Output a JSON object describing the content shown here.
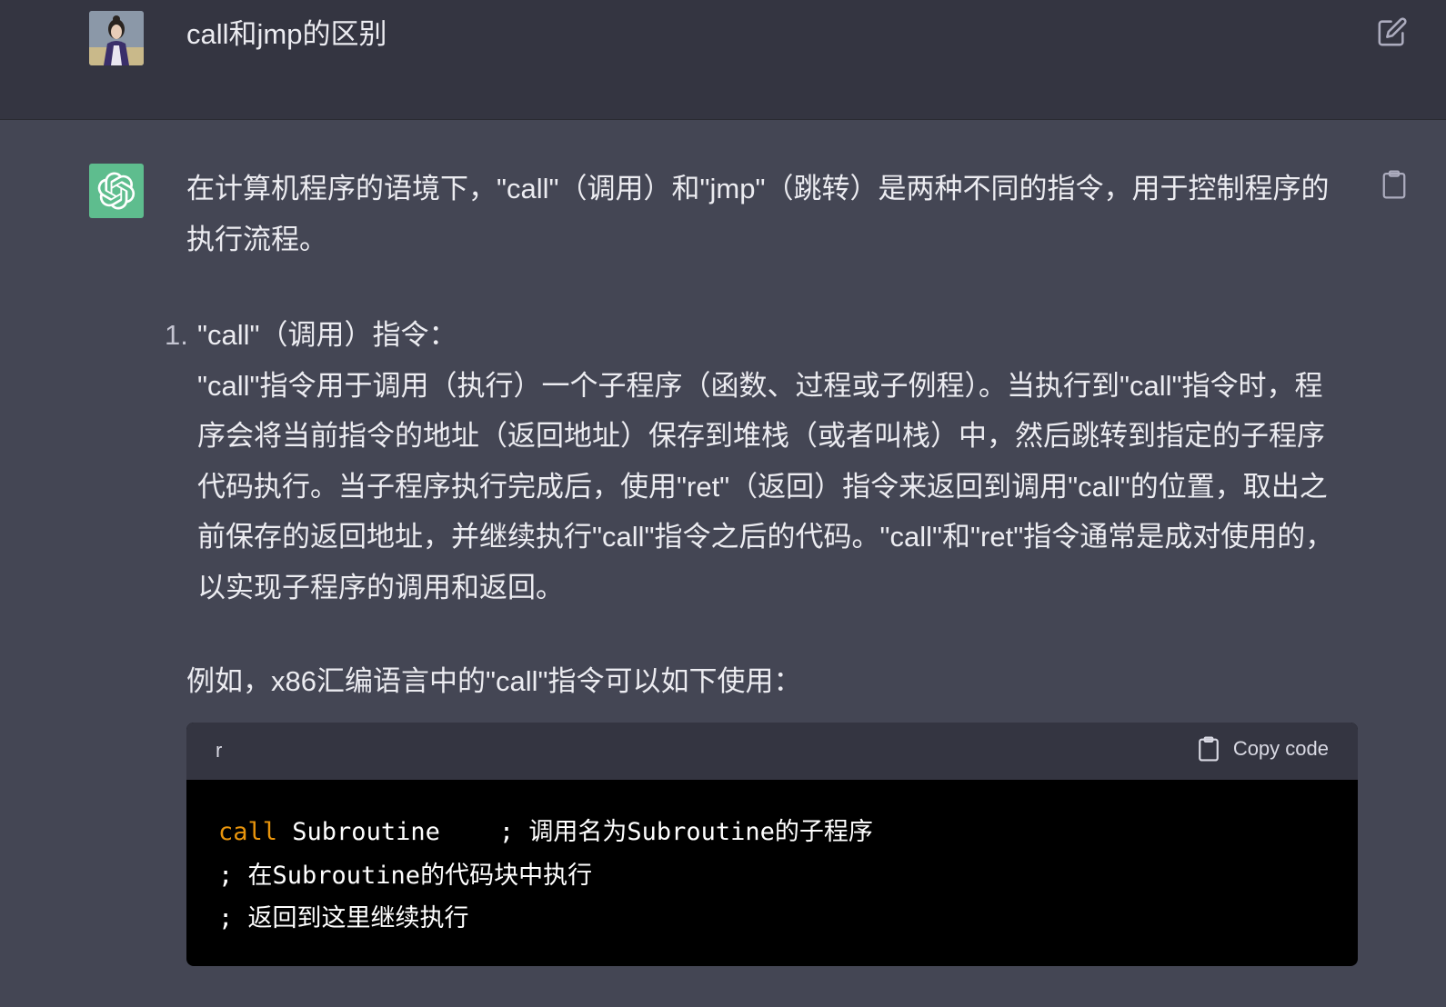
{
  "user_message": {
    "text": "call和jmp的区别"
  },
  "assistant_message": {
    "intro": [
      "在计算机程序的语境下，\"call\"（调用）和\"jmp\"（跳转）是两种不同的指令，用于控制程序的",
      "执行流程。"
    ],
    "list": [
      {
        "number": "1.",
        "title": "\"call\"（调用）指令：",
        "lines": [
          "\"call\"指令用于调用（执行）一个子程序（函数、过程或子例程）。当执行到\"call\"指令时，程",
          "序会将当前指令的地址（返回地址）保存到堆栈（或者叫栈）中，然后跳转到指定的子程序",
          "代码执行。当子程序执行完成后，使用\"ret\"（返回）指令来返回到调用\"call\"的位置，取出之",
          "前保存的返回地址，并继续执行\"call\"指令之后的代码。\"call\"和\"ret\"指令通常是成对使用的，",
          "以实现子程序的调用和返回。"
        ]
      }
    ],
    "example_text": "例如，x86汇编语言中的\"call\"指令可以如下使用："
  },
  "code_block": {
    "language": "r",
    "copy_label": "Copy code",
    "line1_keyword": "call",
    "line1_rest": " Subroutine    ; 调用名为Subroutine的子程序",
    "line2": "; 在Subroutine的代码块中执行",
    "line3": "; 返回到这里继续执行"
  },
  "icons": {
    "edit": "edit-icon",
    "copy_message": "clipboard-icon",
    "copy_code": "clipboard-icon",
    "assistant_logo": "openai-logo-icon"
  },
  "colors": {
    "page_bg": "#444654",
    "user_row_bg": "#343541",
    "assistant_avatar_bg": "#5ebd8e",
    "code_keyword": "#e9950c"
  }
}
